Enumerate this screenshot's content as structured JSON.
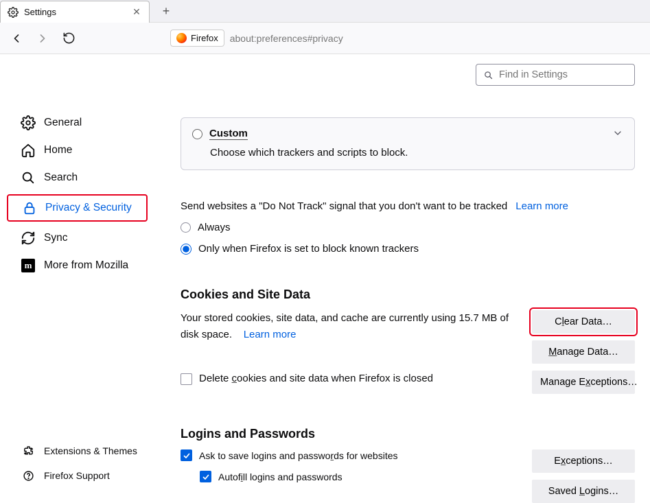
{
  "tab": {
    "title": "Settings"
  },
  "url": {
    "chip": "Firefox",
    "path": "about:preferences#privacy"
  },
  "search": {
    "placeholder": "Find in Settings"
  },
  "sidebar": {
    "items": [
      {
        "label": "General"
      },
      {
        "label": "Home"
      },
      {
        "label": "Search"
      },
      {
        "label": "Privacy & Security"
      },
      {
        "label": "Sync"
      },
      {
        "label": "More from Mozilla"
      }
    ],
    "bottom": [
      {
        "label": "Extensions & Themes"
      },
      {
        "label": "Firefox Support"
      }
    ]
  },
  "custom": {
    "title": "Custom",
    "desc": "Choose which trackers and scripts to block."
  },
  "dnt": {
    "text": "Send websites a \"Do Not Track\" signal that you don't want to be tracked",
    "learn": "Learn more",
    "opt_always": "Always",
    "opt_only": "Only when Firefox is set to block known trackers"
  },
  "cookies": {
    "heading": "Cookies and Site Data",
    "desc_a": "Your stored cookies, site data, and cache are currently using 15.7 MB of disk space.",
    "learn": "Learn more",
    "btn_clear": "Clear Data…",
    "btn_manage": "Manage Data…",
    "btn_except": "Manage Exceptions…",
    "cb_delete": "Delete cookies and site data when Firefox is closed"
  },
  "logins": {
    "heading": "Logins and Passwords",
    "cb_ask": "Ask to save logins and passwords for websites",
    "cb_autofill": "Autofill logins and passwords",
    "btn_except": "Exceptions…",
    "btn_saved": "Saved Logins…"
  }
}
